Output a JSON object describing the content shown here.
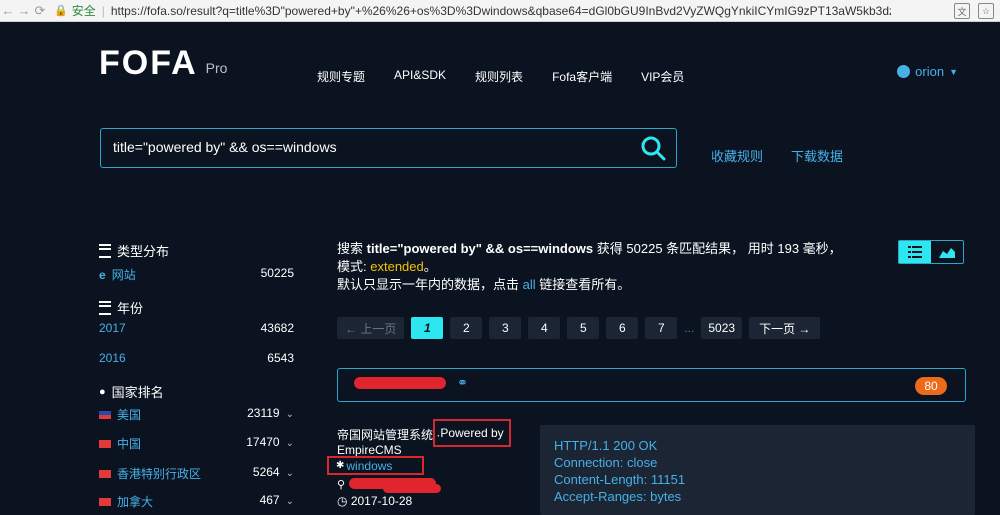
{
  "browser": {
    "secure_label": "安全",
    "url": "https://fofa.so/result?q=title%3D\"powered+by\"+%26%26+os%3D%3Dwindows&qbase64=dGl0bGU9InBvd2VyZWQgYnkiICYmIG9zPT13aW5kb3dz"
  },
  "header": {
    "logo_text": "FOFA",
    "logo_sub": "Pro",
    "nav": [
      "规则专题",
      "API&SDK",
      "规则列表",
      "Fofa客户端",
      "VIP会员"
    ],
    "user": "orion"
  },
  "search": {
    "value": "title=\"powered by\" && os==windows",
    "links": [
      "收藏规则",
      "下载数据"
    ]
  },
  "sidebar": {
    "type_heading": "类型分布",
    "type_items": [
      {
        "name": "网站",
        "count": "50225"
      }
    ],
    "year_heading": "年份",
    "year_items": [
      {
        "name": "2017",
        "count": "43682"
      },
      {
        "name": "2016",
        "count": "6543"
      }
    ],
    "country_heading": "国家排名",
    "country_items": [
      {
        "name": "美国",
        "count": "23119"
      },
      {
        "name": "中国",
        "count": "17470"
      },
      {
        "name": "香港特别行政区",
        "count": "5264"
      },
      {
        "name": "加拿大",
        "count": "467"
      }
    ]
  },
  "summary": {
    "p1": "搜索",
    "query": "title=\"powered by\" && os==windows",
    "p2": "获得 50225 条匹配结果， 用时 193 毫秒，模式:",
    "mode": "extended",
    "p3": "。",
    "line2_a": "默认只显示一年内的数据，点击",
    "all_link": "all",
    "line2_b": "链接查看所有。"
  },
  "pager": {
    "prev": "← 上一页",
    "pages": [
      "1",
      "2",
      "3",
      "4",
      "5",
      "6",
      "7"
    ],
    "ellipsis": "...",
    "last": "5023",
    "next": "下一页 →"
  },
  "result": {
    "score": "80",
    "cms": "帝国网站管理系统 ·",
    "powered_by": "Powered by",
    "cms_name": "EmpireCMS",
    "os": "windows",
    "date": "2017-10-28",
    "http_lines": [
      "HTTP/1.1 200 OK",
      "Connection: close",
      "Content-Length: 11151",
      "Accept-Ranges: bytes"
    ]
  }
}
